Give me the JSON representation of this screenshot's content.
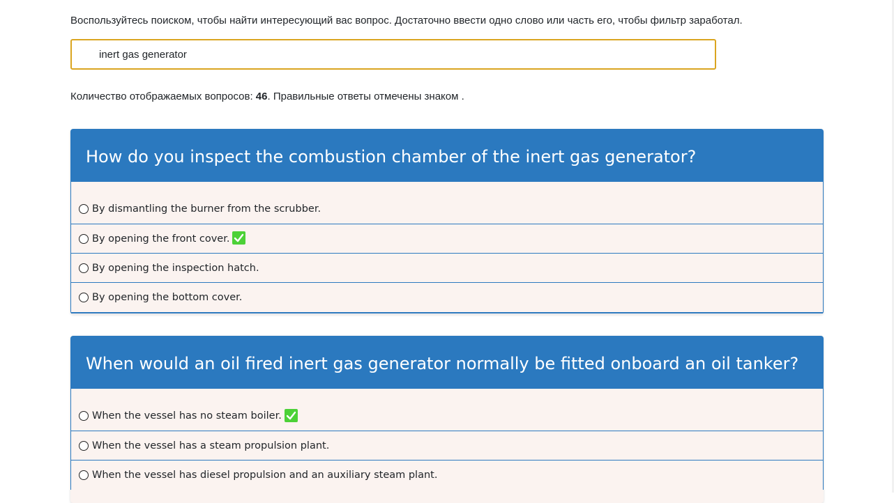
{
  "instructions": "Воспользуйтесь поиском, чтобы найти интересующий вас вопрос. Достаточно ввести одно слово или часть его, чтобы фильтр заработал.",
  "search": {
    "value": "inert gas generator",
    "border_color": "#daa520"
  },
  "count_line": {
    "prefix": "Количество отображаемых вопросов: ",
    "count": "46",
    "suffix": ". Правильные ответы отмечены знаком ."
  },
  "colors": {
    "header_bg": "#2b79bf",
    "answer_bg": "#fbf3f0",
    "correct_mark": "#4cd137"
  },
  "questions": [
    {
      "title": "How do you inspect the combustion chamber of the inert gas generator?",
      "answers": [
        {
          "text": "By dismantling the burner from the scrubber.",
          "correct": false
        },
        {
          "text": "By opening the front cover.",
          "correct": true
        },
        {
          "text": "By opening the inspection hatch.",
          "correct": false
        },
        {
          "text": "By opening the bottom cover.",
          "correct": false
        }
      ]
    },
    {
      "title": "When would an oil fired inert gas generator normally be fitted onboard an oil tanker?",
      "answers": [
        {
          "text": "When the vessel has no steam boiler.",
          "correct": true
        },
        {
          "text": "When the vessel has a steam propulsion plant.",
          "correct": false
        },
        {
          "text": "When the vessel has diesel propulsion and an auxiliary steam plant.",
          "correct": false
        }
      ]
    }
  ]
}
